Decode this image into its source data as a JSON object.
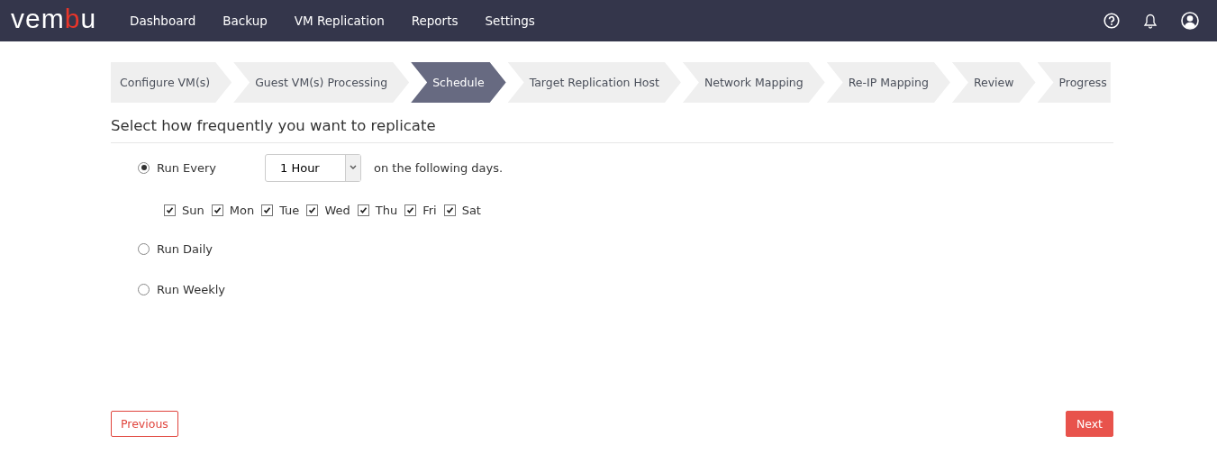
{
  "header": {
    "logo": {
      "before": "vem",
      "accent": "b",
      "after": "u"
    },
    "nav": [
      {
        "label": "Dashboard",
        "selected": false
      },
      {
        "label": "Backup",
        "selected": false
      },
      {
        "label": "VM Replication",
        "selected": false
      },
      {
        "label": "Reports",
        "selected": false
      },
      {
        "label": "Settings",
        "selected": false
      }
    ]
  },
  "steps": [
    {
      "label": "Configure VM(s)",
      "selected": false
    },
    {
      "label": "Guest VM(s) Processing",
      "selected": false
    },
    {
      "label": "Schedule",
      "selected": true
    },
    {
      "label": "Target Replication Host",
      "selected": false
    },
    {
      "label": "Network Mapping",
      "selected": false
    },
    {
      "label": "Re-IP Mapping",
      "selected": false
    },
    {
      "label": "Review",
      "selected": false
    },
    {
      "label": "Progress",
      "selected": false
    }
  ],
  "section_title": "Select how frequently you want to replicate",
  "options": [
    {
      "label": "Run Every",
      "selected": true,
      "interval": "1 Hour",
      "suffix": "on the following days.",
      "days": [
        {
          "label": "Sun",
          "checked": true
        },
        {
          "label": "Mon",
          "checked": true
        },
        {
          "label": "Tue",
          "checked": true
        },
        {
          "label": "Wed",
          "checked": true
        },
        {
          "label": "Thu",
          "checked": true
        },
        {
          "label": "Fri",
          "checked": true
        },
        {
          "label": "Sat",
          "checked": true
        }
      ]
    },
    {
      "label": "Run Daily",
      "selected": false
    },
    {
      "label": "Run Weekly",
      "selected": false
    }
  ],
  "buttons": {
    "previous": "Previous",
    "next": "Next"
  }
}
